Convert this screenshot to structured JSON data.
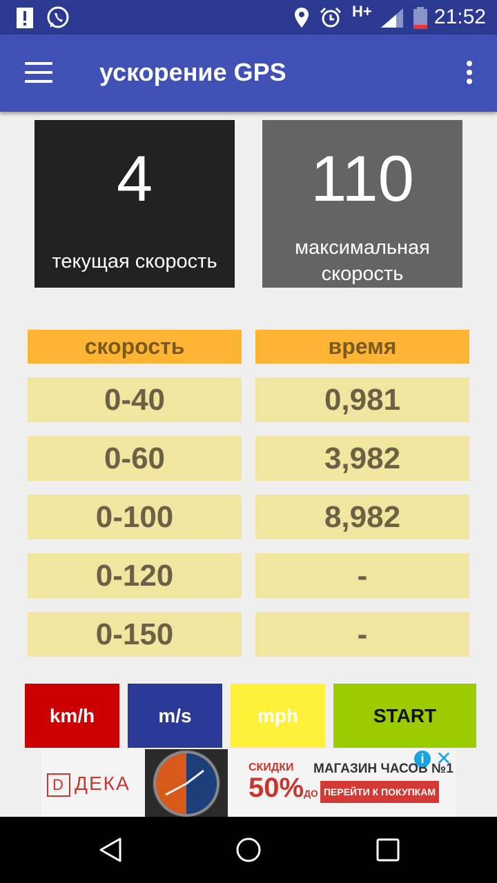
{
  "status_bar": {
    "time": "21:52",
    "network": "H+",
    "icons": [
      "alert-icon",
      "whatsapp-icon",
      "location-icon",
      "alarm-icon",
      "network-h-plus-icon",
      "signal-icon",
      "battery-icon"
    ]
  },
  "app_bar": {
    "title": "ускорение GPS",
    "icons": [
      "menu-icon",
      "more-vert-icon"
    ]
  },
  "current_speed": {
    "value": "4",
    "label": "текущая скорость"
  },
  "max_speed": {
    "value": "110",
    "label": "максимальная скорость"
  },
  "table": {
    "headers": [
      "скорость",
      "время"
    ],
    "rows": [
      {
        "range": "0-40",
        "time": "0,981"
      },
      {
        "range": "0-60",
        "time": "3,982"
      },
      {
        "range": "0-100",
        "time": "8,982"
      },
      {
        "range": "0-120",
        "time": "-"
      },
      {
        "range": "0-150",
        "time": "-"
      }
    ]
  },
  "buttons": {
    "kmh": "km/h",
    "ms": "m/s",
    "mph": "mph",
    "start": "START"
  },
  "ad": {
    "brand": "ДЕКА",
    "discount_label": "СКИДКИ",
    "discount_value": "50%",
    "discount_prefix": "ДО",
    "shop": "МАГАЗИН ЧАСОВ №1",
    "cta": "ПЕРЕЙТИ К ПОКУПКАМ"
  },
  "colors": {
    "app_bar": "#3f51b5",
    "status_bar": "#2b3a90",
    "kmh": "#cc0000",
    "ms": "#2b3a97",
    "mph": "#fff13a",
    "start": "#9acc00",
    "table_header": "#ffb533",
    "table_row": "#f1e6a0"
  }
}
